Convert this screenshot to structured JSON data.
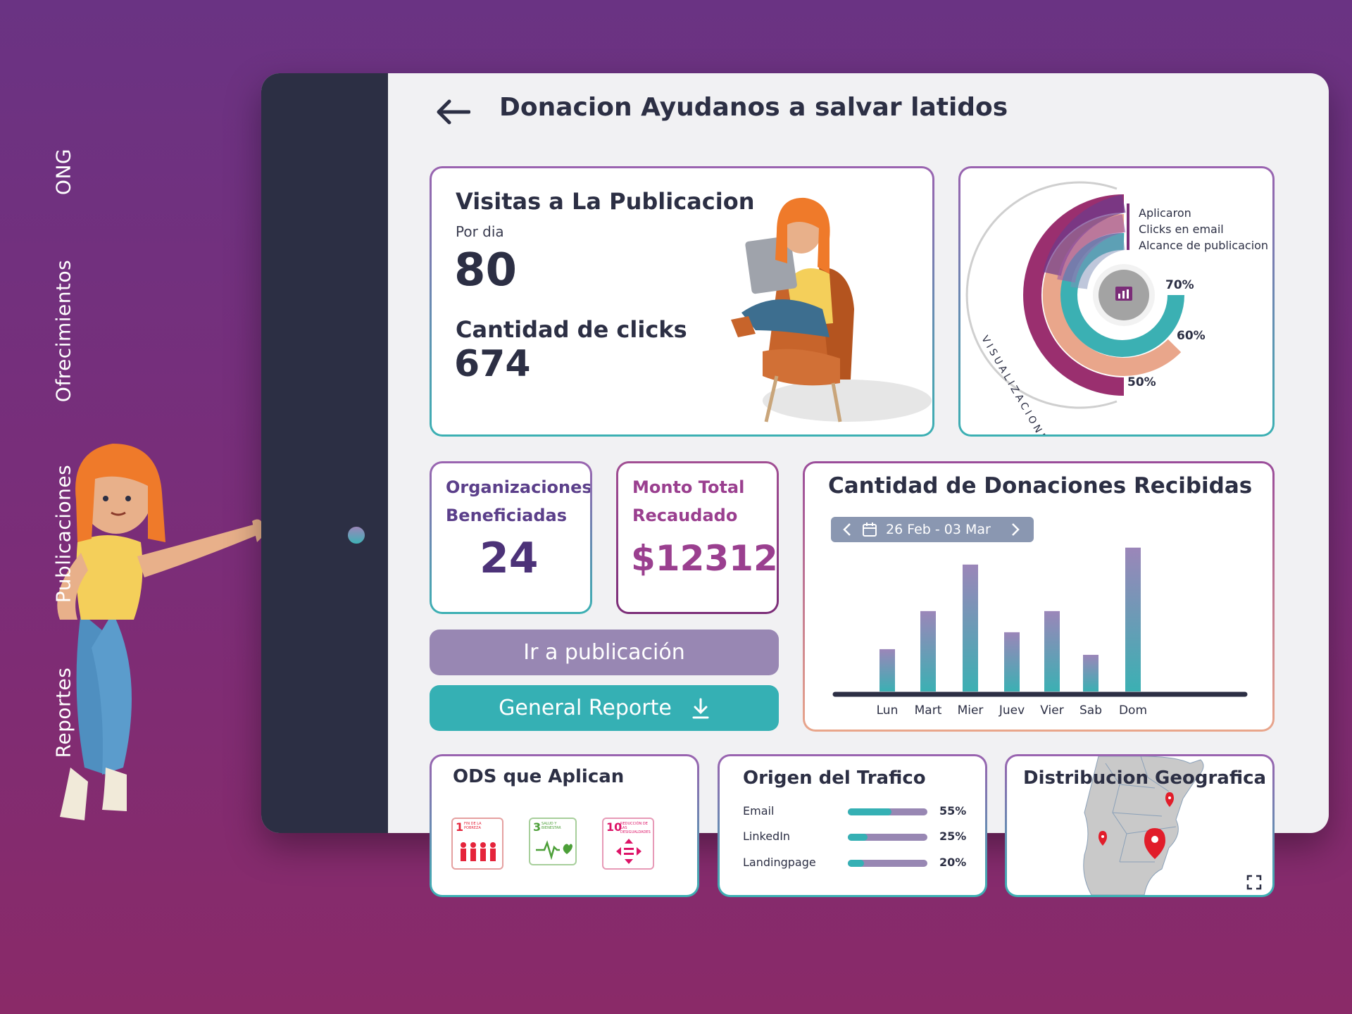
{
  "sidebar": {
    "items": [
      {
        "label": "ONG"
      },
      {
        "label": "Ofrecimientos"
      },
      {
        "label": "Publicaciones"
      },
      {
        "label": "Reportes"
      }
    ]
  },
  "header": {
    "title": "Donacion Ayudanos a salvar latidos"
  },
  "visits": {
    "title": "Visitas a La Publicacion",
    "per_day_label": "Por dia",
    "per_day_value": "80",
    "clicks_label": "Cantidad de clicks",
    "clicks_value": "674"
  },
  "views_chart": {
    "legend": [
      "Aplicaron",
      "Clicks en email",
      "Alcance de publicacion"
    ],
    "percents": [
      "70%",
      "60%",
      "50%"
    ],
    "arc_label": "VISUALIZACIONES",
    "colors": [
      "#3bb0b3",
      "#e9a68b",
      "#9a2f6f"
    ]
  },
  "orgs": {
    "label_line1": "Organizaciones",
    "label_line2": "Beneficiadas",
    "value": "24"
  },
  "amount": {
    "label_line1": "Monto Total",
    "label_line2": "Recaudado",
    "value": "$12312"
  },
  "buttons": {
    "go_to_post": "Ir a publicación",
    "report": "General Reporte"
  },
  "chart_data": {
    "type": "bar",
    "title": "Cantidad de Donaciones Recibidas",
    "date_range": "26 Feb - 03 Mar",
    "categories": [
      "Lun",
      "Mart",
      "Mier",
      "Juev",
      "Vier",
      "Sab",
      "Dom"
    ],
    "values": [
      30,
      57,
      90,
      42,
      57,
      26,
      102
    ],
    "ylim": [
      0,
      110
    ],
    "colors": {
      "top": "#9b86b9",
      "bottom": "#3bb0b3"
    }
  },
  "ods": {
    "title": "ODS que Aplican",
    "items": [
      {
        "number": "1",
        "text": "FIN DE LA POBREZA",
        "color": "#e5243b"
      },
      {
        "number": "3",
        "text": "SALUD Y BIENESTAR",
        "color": "#4c9f38"
      },
      {
        "number": "10",
        "text": "REDUCCIÓN DE LAS DESIGUALDADES",
        "color": "#dd1367"
      }
    ]
  },
  "traffic": {
    "title": "Origen del Trafico",
    "rows": [
      {
        "label": "Email",
        "pct": "55%",
        "value": 0.55
      },
      {
        "label": "LinkedIn",
        "pct": "25%",
        "value": 0.25
      },
      {
        "label": "Landingpage",
        "pct": "20%",
        "value": 0.2
      }
    ]
  },
  "geo": {
    "title": "Distribucion Geografica"
  }
}
